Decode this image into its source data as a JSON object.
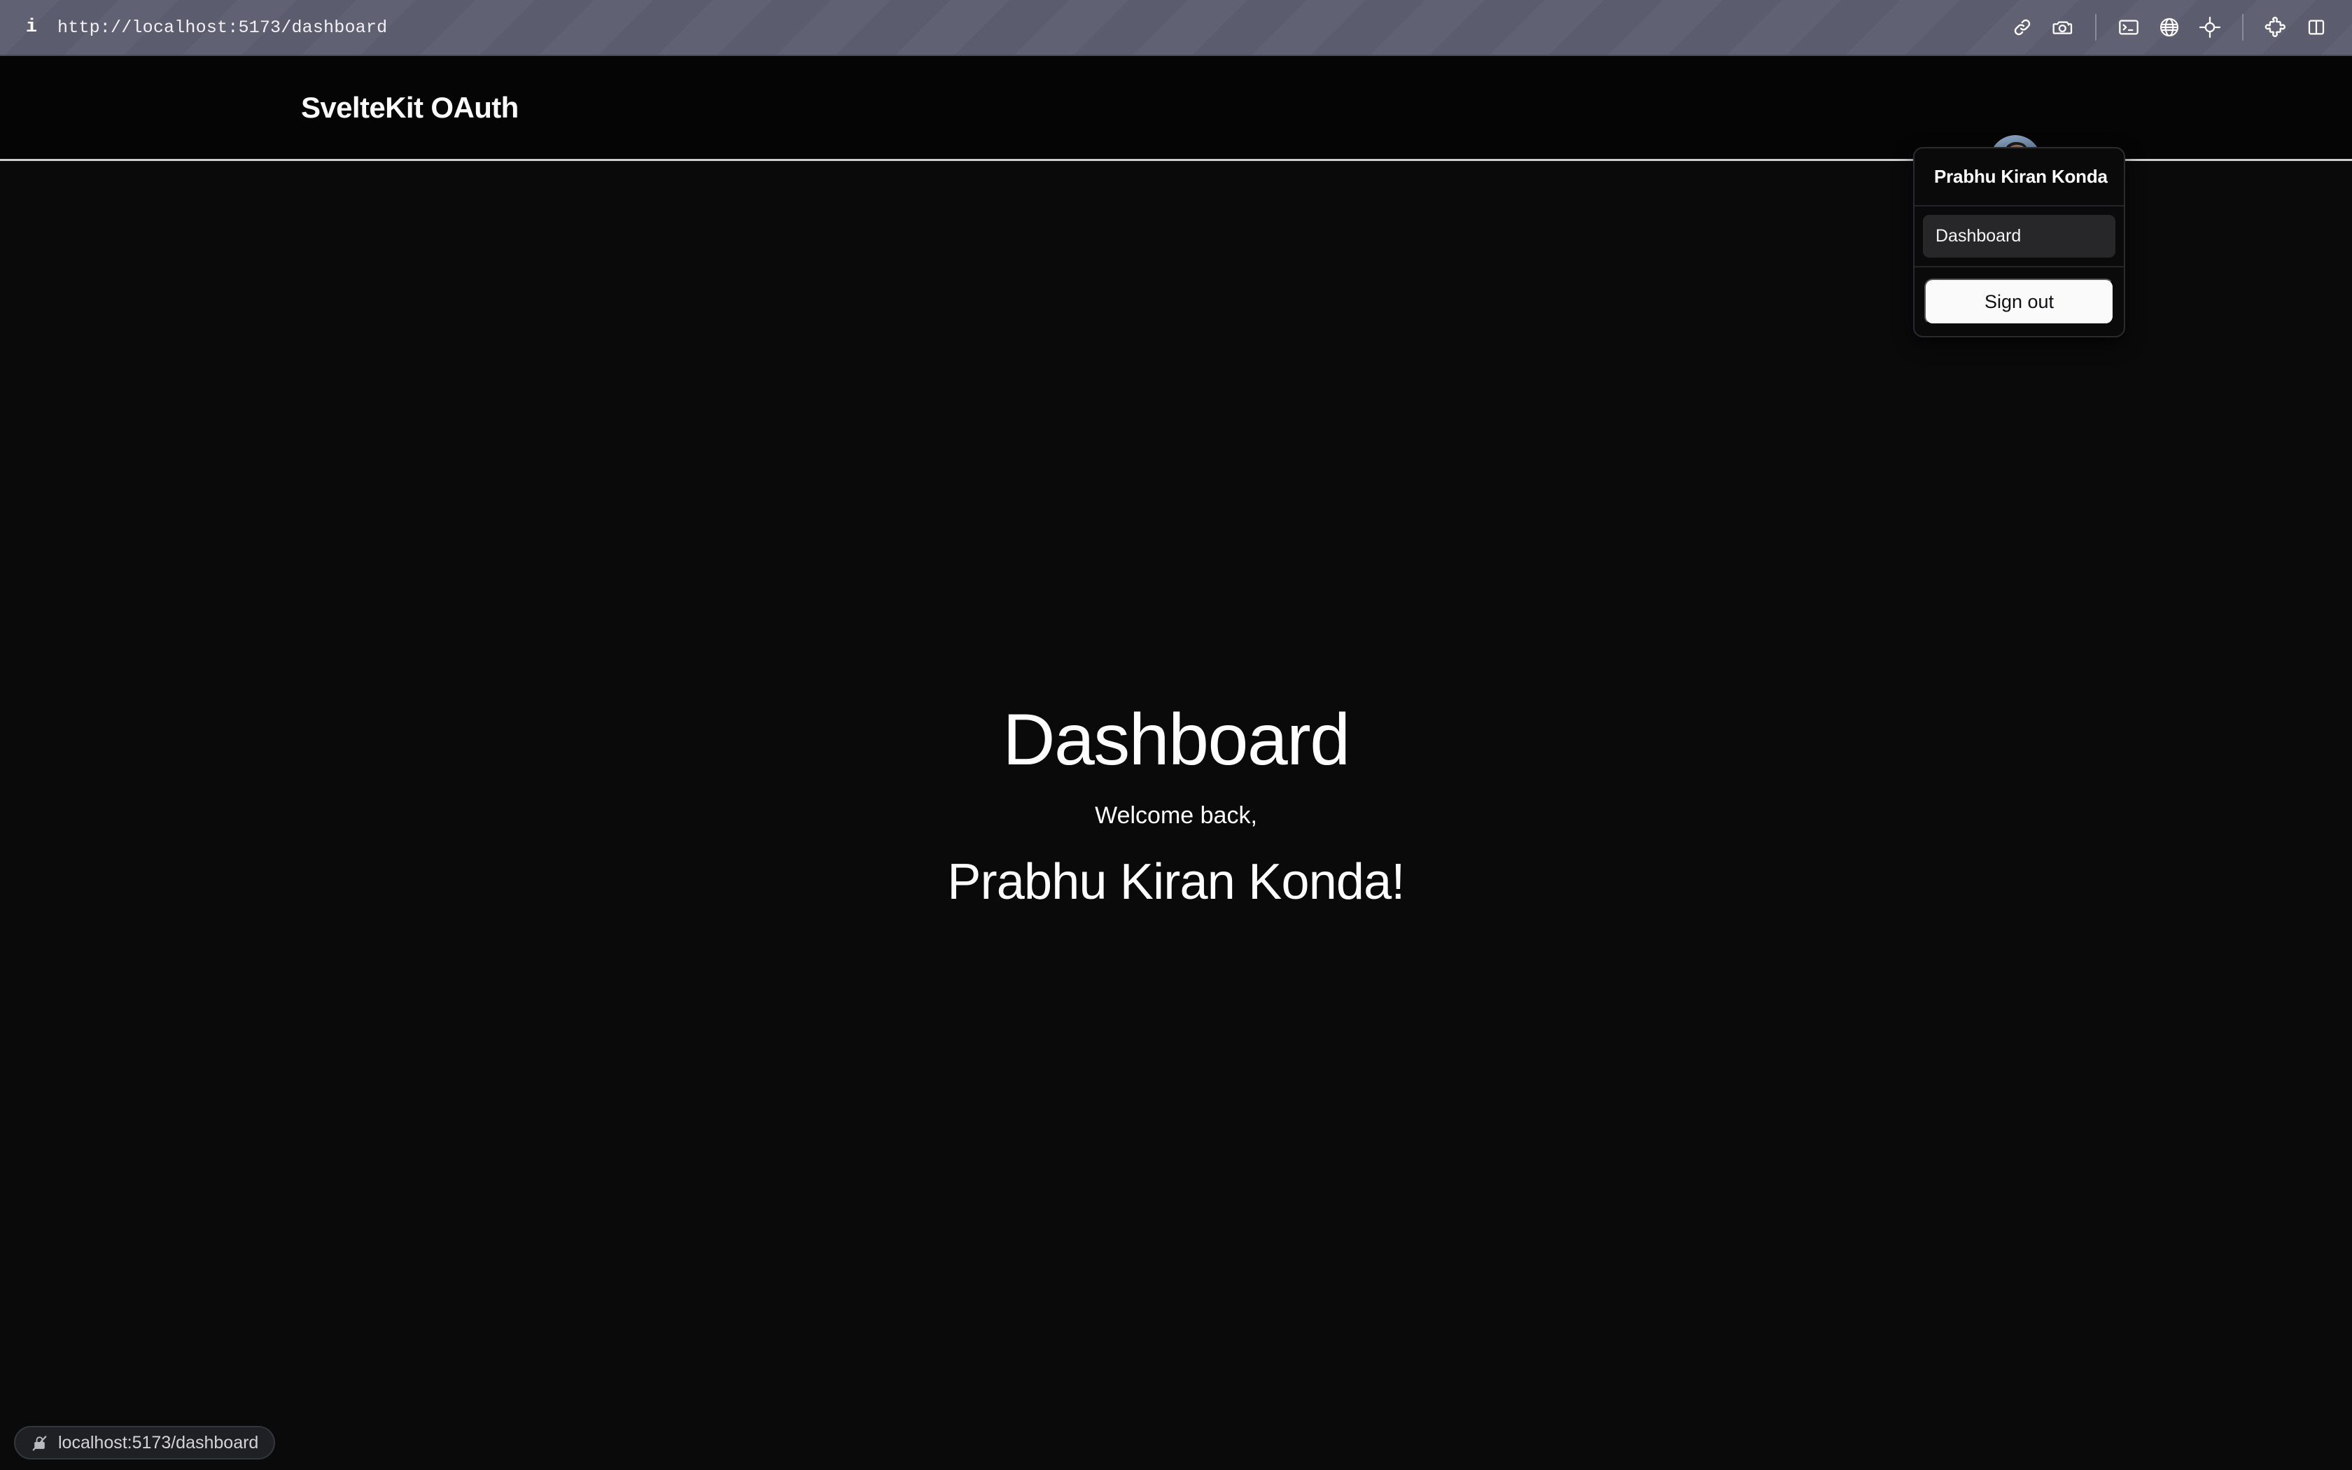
{
  "browser_bar": {
    "info_icon": "info-icon",
    "url": "http://localhost:5173/dashboard",
    "toolbar_icons": [
      {
        "name": "link-icon",
        "label": "Copy link"
      },
      {
        "name": "camera-icon",
        "label": "Screenshot"
      },
      {
        "name": "separator-1",
        "label": ""
      },
      {
        "name": "terminal-icon",
        "label": "Console"
      },
      {
        "name": "globe-icon",
        "label": "Network"
      },
      {
        "name": "crosshair-icon",
        "label": "Inspect element"
      },
      {
        "name": "separator-2",
        "label": ""
      },
      {
        "name": "puzzle-icon",
        "label": "Extensions"
      },
      {
        "name": "split-panel-icon",
        "label": "Toggle panel"
      }
    ]
  },
  "site_header": {
    "brand": "SvelteKit OAuth",
    "avatar": {
      "name": "user-avatar",
      "alt": "Prabhu Kiran Konda profile photo"
    }
  },
  "user_menu": {
    "name": "Prabhu Kiran Konda",
    "links": [
      {
        "label": "Dashboard",
        "active": true
      }
    ],
    "signout_label": "Sign out"
  },
  "main": {
    "title": "Dashboard",
    "welcome": "Welcome back,",
    "user_name": "Prabhu Kiran Konda!"
  },
  "status_bar": {
    "lock_icon": "lock-crossed-icon",
    "url": "localhost:5173/dashboard"
  },
  "colors": {
    "browser_bar_bg": "#5d5f70",
    "page_bg": "#0a0a0a",
    "header_bg": "#050505",
    "header_border": "#cfcfcf",
    "menu_bg": "#0a0a0a",
    "menu_item_active_bg": "#27272a",
    "signout_bg": "#fafafa",
    "text_primary": "#ffffff",
    "status_pill_bg": "#1f2024"
  }
}
